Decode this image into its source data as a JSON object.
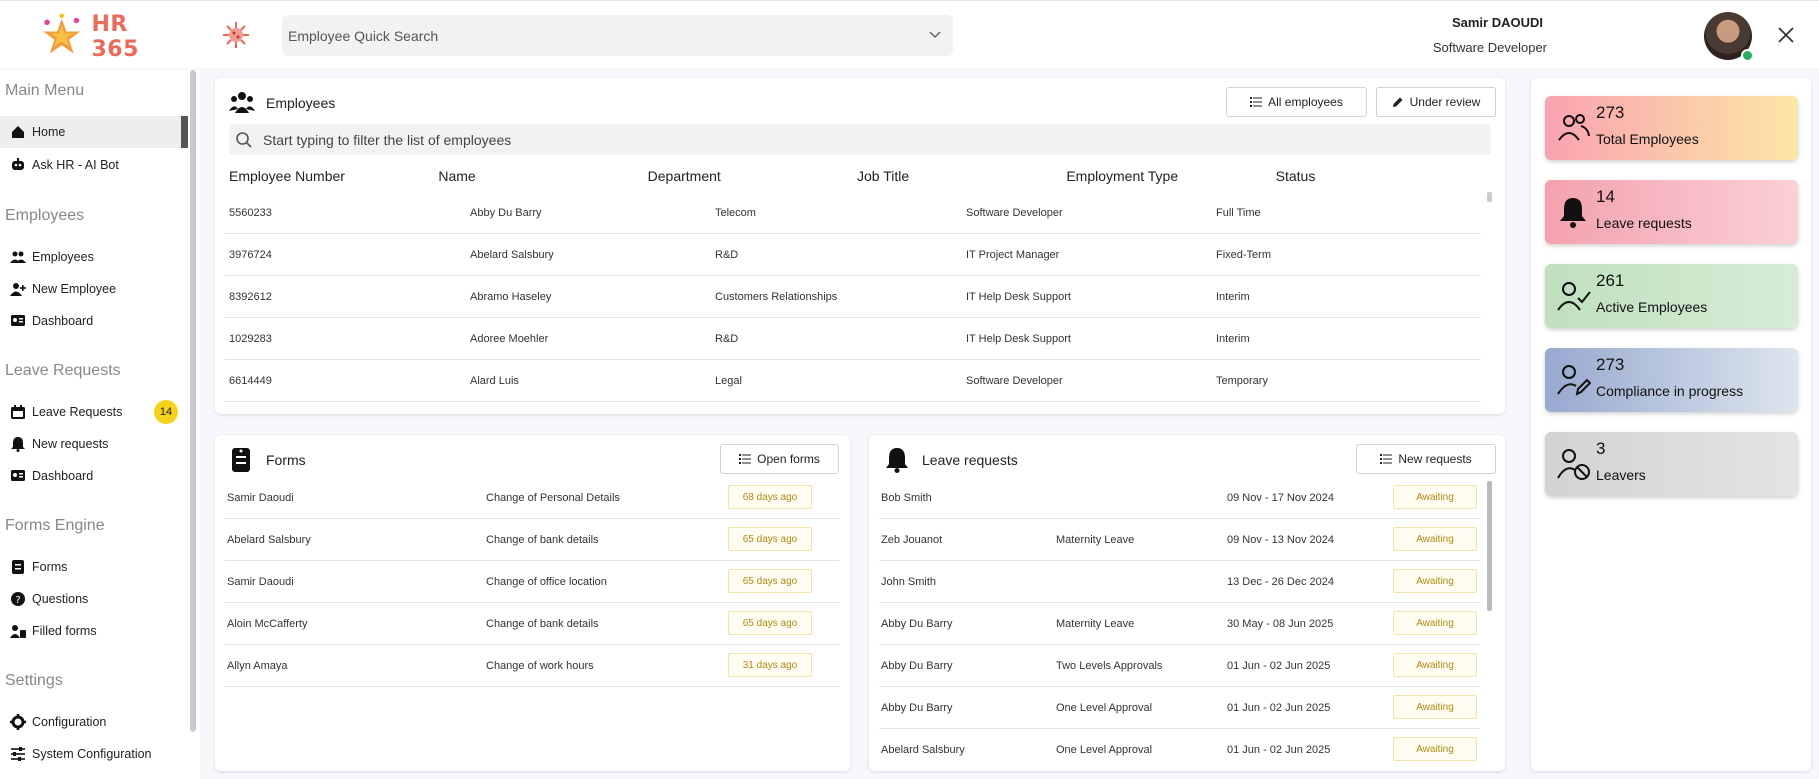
{
  "app": {
    "logo_text": "HR 365"
  },
  "search": {
    "placeholder": "Employee Quick Search"
  },
  "user": {
    "name": "Samir DAOUDI",
    "role": "Software Developer"
  },
  "sidebar": {
    "sections": [
      {
        "title": "Main Menu",
        "items": [
          {
            "label": "Home",
            "icon": "home-icon"
          },
          {
            "label": "Ask HR - AI Bot",
            "icon": "robot-icon"
          }
        ]
      },
      {
        "title": "Employees",
        "items": [
          {
            "label": "Employees",
            "icon": "users-icon"
          },
          {
            "label": "New Employee",
            "icon": "user-plus-icon"
          },
          {
            "label": "Dashboard",
            "icon": "dashboard-icon"
          }
        ]
      },
      {
        "title": "Leave Requests",
        "items": [
          {
            "label": "Leave Requests",
            "icon": "calendar-icon",
            "badge": "14"
          },
          {
            "label": "New requests",
            "icon": "bell-icon"
          },
          {
            "label": "Dashboard",
            "icon": "dashboard-icon"
          }
        ]
      },
      {
        "title": "Forms Engine",
        "items": [
          {
            "label": "Forms",
            "icon": "form-icon"
          },
          {
            "label": "Questions",
            "icon": "question-icon"
          },
          {
            "label": "Filled forms",
            "icon": "user-doc-icon"
          }
        ]
      },
      {
        "title": "Settings",
        "items": [
          {
            "label": "Configuration",
            "icon": "gear-icon"
          },
          {
            "label": "System Configuration",
            "icon": "sliders-icon"
          }
        ]
      }
    ]
  },
  "employees": {
    "title": "Employees",
    "btn_all": "All employees",
    "btn_review": "Under review",
    "filter_placeholder": "Start typing to filter the list of employees",
    "columns": [
      "Employee Number",
      "Name",
      "Department",
      "Job Title",
      "Employment Type",
      "Status"
    ],
    "rows": [
      {
        "number": "5560233",
        "name": "Abby Du Barry",
        "department": "Telecom",
        "job": "Software Developer",
        "type": "Full Time"
      },
      {
        "number": "3976724",
        "name": "Abelard Salsbury",
        "department": "R&D",
        "job": "IT Project Manager",
        "type": "Fixed-Term"
      },
      {
        "number": "8392612",
        "name": "Abramo Haseley",
        "department": "Customers Relationships",
        "job": "IT Help Desk Support",
        "type": "Interim"
      },
      {
        "number": "1029283",
        "name": "Adoree Moehler",
        "department": "R&D",
        "job": "IT Help Desk Support",
        "type": "Interim"
      },
      {
        "number": "6614449",
        "name": "Alard Luis",
        "department": "Legal",
        "job": "Software Developer",
        "type": "Temporary"
      }
    ]
  },
  "forms": {
    "title": "Forms",
    "btn_open": "Open forms",
    "rows": [
      {
        "name": "Samir Daoudi",
        "form": "Change of Personal Details",
        "age": "68 days ago"
      },
      {
        "name": "Abelard Salsbury",
        "form": "Change of bank details",
        "age": "65 days ago"
      },
      {
        "name": "Samir Daoudi",
        "form": "Change of office location",
        "age": "65 days ago"
      },
      {
        "name": "Aloin McCafferty",
        "form": "Change of bank details",
        "age": "65 days ago"
      },
      {
        "name": "Allyn Amaya",
        "form": "Change of work hours",
        "age": "31 days ago"
      }
    ]
  },
  "leave": {
    "title": "Leave requests",
    "btn_new": "New requests",
    "rows": [
      {
        "name": "Bob Smith",
        "type": "",
        "dates": "09 Nov - 17 Nov 2024",
        "status": "Awaiting"
      },
      {
        "name": "Zeb Jouanot",
        "type": "Maternity Leave",
        "dates": "09 Nov - 13 Nov 2024",
        "status": "Awaiting"
      },
      {
        "name": "John Smith",
        "type": "",
        "dates": "13 Dec - 26 Dec 2024",
        "status": "Awaiting"
      },
      {
        "name": "Abby Du Barry",
        "type": "Maternity Leave",
        "dates": "30 May - 08 Jun 2025",
        "status": "Awaiting"
      },
      {
        "name": "Abby Du Barry",
        "type": "Two Levels Approvals",
        "dates": "01 Jun - 02 Jun 2025",
        "status": "Awaiting"
      },
      {
        "name": "Abby Du Barry",
        "type": "One Level Approval",
        "dates": "01 Jun - 02 Jun 2025",
        "status": "Awaiting"
      },
      {
        "name": "Abelard Salsbury",
        "type": "One Level Approval",
        "dates": "01 Jun - 02 Jun 2025",
        "status": "Awaiting"
      }
    ]
  },
  "stats": [
    {
      "value": "273",
      "label": "Total Employees",
      "icon": "users-outline-icon",
      "gradient": [
        "#f9a3b0",
        "#fce7a5"
      ]
    },
    {
      "value": "14",
      "label": "Leave requests",
      "icon": "bell-icon",
      "gradient": [
        "#f3a2ad",
        "#fbd0d6"
      ]
    },
    {
      "value": "261",
      "label": "Active Employees",
      "icon": "user-check-icon",
      "gradient": [
        "#bfe0bf",
        "#d7ecd7"
      ]
    },
    {
      "value": "273",
      "label": "Compliance in progress",
      "icon": "user-edit-icon",
      "gradient": [
        "#98a8cf",
        "#dde6ee"
      ]
    },
    {
      "value": "3",
      "label": "Leavers",
      "icon": "user-off-icon",
      "gradient": [
        "#d3d3d3",
        "#e4e4e4"
      ]
    }
  ]
}
